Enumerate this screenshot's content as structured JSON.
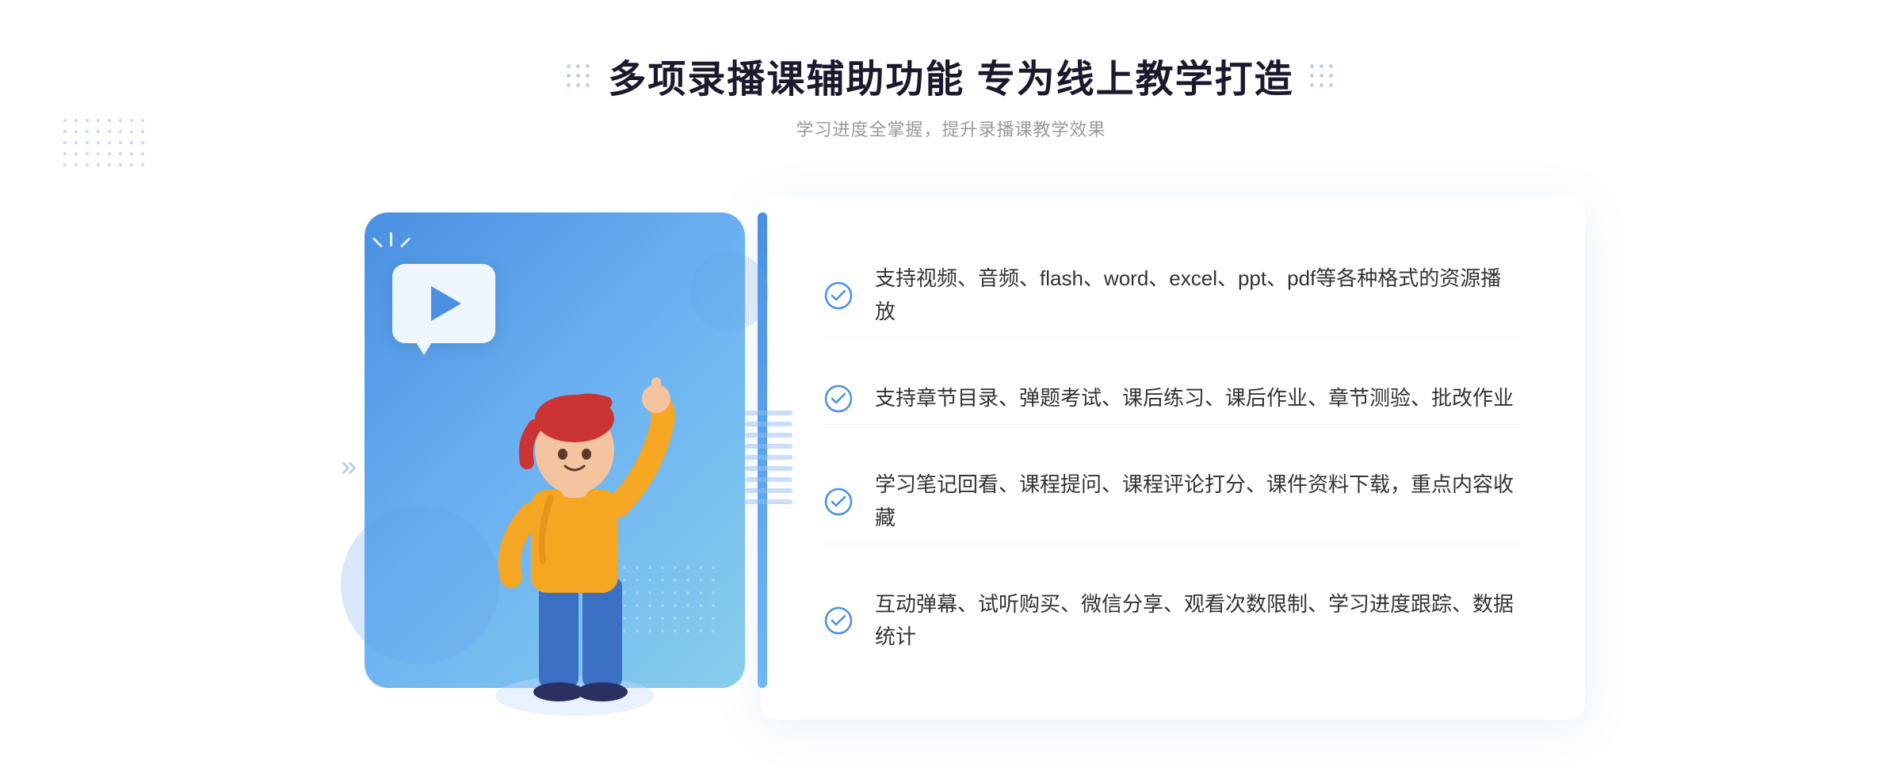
{
  "header": {
    "title": "多项录播课辅助功能 专为线上教学打造",
    "subtitle": "学习进度全掌握，提升录播课教学效果",
    "dots_left": "decorative",
    "dots_right": "decorative"
  },
  "features": [
    {
      "id": 1,
      "text": "支持视频、音频、flash、word、excel、ppt、pdf等各种格式的资源播放"
    },
    {
      "id": 2,
      "text": "支持章节目录、弹题考试、课后练习、课后作业、章节测验、批改作业"
    },
    {
      "id": 3,
      "text": "学习笔记回看、课程提问、课程评论打分、课件资料下载，重点内容收藏"
    },
    {
      "id": 4,
      "text": "互动弹幕、试听购买、微信分享、观看次数限制、学习进度跟踪、数据统计"
    }
  ],
  "decoration": {
    "play_icon": "▶",
    "chevron_left": "«",
    "check_symbol": "✓"
  },
  "colors": {
    "primary_blue": "#4a90e2",
    "light_blue": "#87ceeb",
    "text_dark": "#1a1a2e",
    "text_gray": "#999999",
    "text_body": "#333333",
    "accent_blue": "#5b9bd5"
  }
}
